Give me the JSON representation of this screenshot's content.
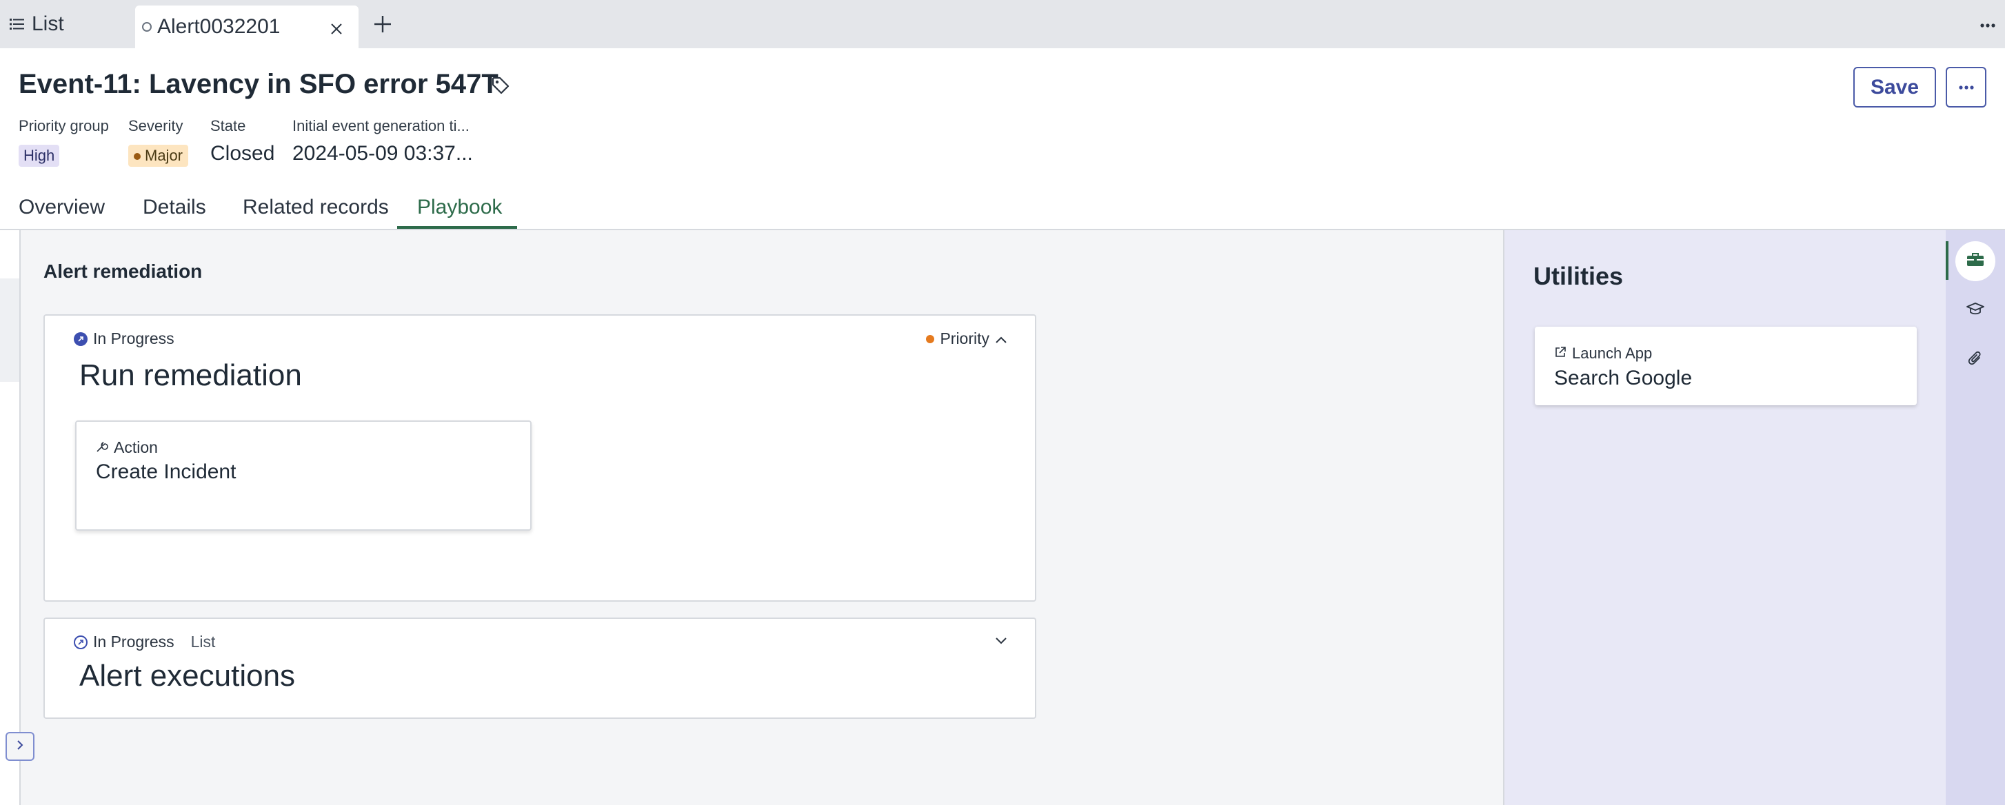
{
  "tabs": {
    "list_label": "List",
    "active_label": "Alert0032201"
  },
  "header": {
    "title": "Event-11: Lavency in SFO error 547T",
    "save_label": "Save",
    "fields": {
      "priority_group": {
        "label": "Priority group",
        "value": "High"
      },
      "severity": {
        "label": "Severity",
        "value": "Major"
      },
      "state": {
        "label": "State",
        "value": "Closed"
      },
      "initial_time": {
        "label": "Initial event generation ti...",
        "value": "2024-05-09 03:37..."
      }
    }
  },
  "nav": {
    "tabs": [
      "Overview",
      "Details",
      "Related records",
      "Playbook"
    ],
    "active": "Playbook"
  },
  "main": {
    "section_title": "Alert remediation",
    "card1": {
      "status": "In Progress",
      "title": "Run remediation",
      "priority_label": "Priority",
      "action": {
        "kind": "Action",
        "name": "Create Incident"
      }
    },
    "card2": {
      "status": "In Progress",
      "type": "List",
      "title": "Alert executions"
    }
  },
  "utilities": {
    "title": "Utilities",
    "item": {
      "kind": "Launch App",
      "name": "Search Google"
    }
  },
  "colors": {
    "accent": "#2d6b4a",
    "button_border": "#4a5aa8",
    "status_icon": "#3d4fb0",
    "priority_dot": "#e57a1e",
    "utilities_bg": "#e8e8f6"
  },
  "icons": [
    "list-icon",
    "tab-loading-icon",
    "close-icon",
    "plus-icon",
    "more-horizontal-icon",
    "tag-icon",
    "in-progress-icon",
    "chevron-up-icon",
    "chevron-down-icon",
    "wrench-icon",
    "external-link-icon",
    "toolbox-icon",
    "graduation-cap-icon",
    "paperclip-icon",
    "chevron-right-icon"
  ]
}
